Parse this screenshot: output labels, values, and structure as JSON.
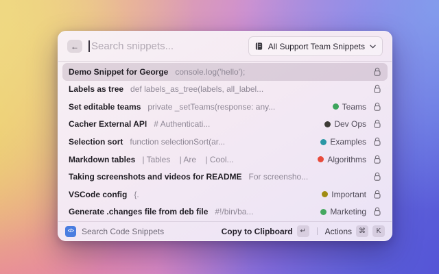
{
  "window": {
    "header": {
      "back_icon": "←",
      "search_placeholder": "Search snippets...",
      "dropdown": {
        "label": "All Support Team Snippets"
      }
    },
    "list": {
      "rows": [
        {
          "title": "Demo Snippet for George",
          "preview": "console.log('hello');",
          "selected": true,
          "locked": true
        },
        {
          "title": "Labels as tree",
          "preview": "def labels_as_tree(labels, all_label...",
          "locked": true
        },
        {
          "title": "Set editable teams",
          "preview": "private _setTeams(response: any...",
          "tag": {
            "label": "Teams",
            "color": "#3da45c"
          },
          "locked": true
        },
        {
          "title": "Cacher External API",
          "preview": "# Authenticati...",
          "tag": {
            "label": "Dev Ops",
            "color": "#3d3b36"
          },
          "locked": true
        },
        {
          "title": "Selection sort",
          "preview": "function selectionSort(ar...",
          "tag": {
            "label": "Examples",
            "color": "#2b97a5"
          },
          "locked": true
        },
        {
          "title": "Markdown tables",
          "preview": "| Tables    | Are    | Cool...",
          "tag": {
            "label": "Algorithms",
            "color": "#e84b3c"
          },
          "locked": true
        },
        {
          "title": "Taking screenshots and videos for README",
          "preview": "For screensho...",
          "locked": true
        },
        {
          "title": "VSCode config",
          "preview": "{.",
          "tag": {
            "label": "Important",
            "color": "#a08c13"
          },
          "locked": true
        },
        {
          "title": "Generate .changes file from deb file",
          "preview": "#!/bin/ba...",
          "tag": {
            "label": "Marketing",
            "color": "#45a860"
          },
          "locked": true
        }
      ]
    },
    "footer": {
      "app_icon_glyph": "</>",
      "app_icon_color": "#4a7de0",
      "app_name": "Search Code Snippets",
      "primary_action": "Copy to Clipboard",
      "primary_key": "↵",
      "actions_label": "Actions",
      "actions_keys": [
        "⌘",
        "K"
      ]
    }
  }
}
